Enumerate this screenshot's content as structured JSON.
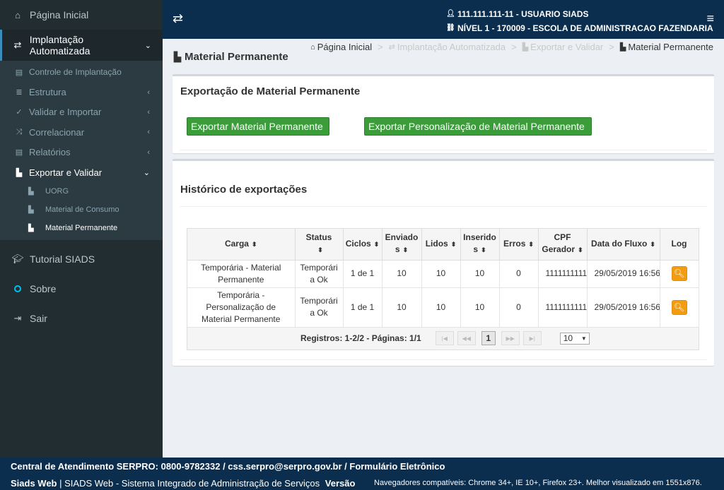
{
  "sidebar": {
    "home": "Página Inicial",
    "implantacao": "Implantação Automatizada",
    "sub": [
      {
        "label": "Controle de Implantação"
      },
      {
        "label": "Estrutura"
      },
      {
        "label": "Validar e Importar"
      },
      {
        "label": "Correlacionar"
      },
      {
        "label": "Relatórios"
      },
      {
        "label": "Exportar e Validar"
      }
    ],
    "sub2": [
      {
        "label": "UORG"
      },
      {
        "label": "Material de Consumo"
      },
      {
        "label": "Material Permanente"
      }
    ],
    "tutorial": "Tutorial SIADS",
    "sobre": "Sobre",
    "sair": "Sair"
  },
  "header": {
    "user": "111.111.111-11 - USUARIO SIADS",
    "level": "NÍVEL 1 - 170009 - ESCOLA DE ADMINISTRACAO FAZENDARIA"
  },
  "page": {
    "title": "Material Permanente",
    "breadcrumb": [
      "Página Inicial",
      "Implantação Automatizada",
      "Exportar e Validar",
      "Material Permanente"
    ]
  },
  "export_box": {
    "title": "Exportação de Material Permanente",
    "btn1": "Exportar Material Permanente",
    "btn2": "Exportar Personalização de Material Permanente"
  },
  "history": {
    "title": "Histórico de exportações",
    "columns": [
      "Carga",
      "Status",
      "Ciclos",
      "Enviados",
      "Lidos",
      "Inseridos",
      "Erros",
      "CPF Gerador",
      "Data do Fluxo",
      "Log"
    ],
    "rows": [
      {
        "carga": "Temporária - Material Permanente",
        "status": "Temporária Ok",
        "ciclos": "1 de 1",
        "enviados": "10",
        "lidos": "10",
        "inseridos": "10",
        "erros": "0",
        "cpf": "11111111111",
        "data": "29/05/2019 16:56"
      },
      {
        "carga": "Temporária - Personalização de Material Permanente",
        "status": "Temporária Ok",
        "ciclos": "1 de 1",
        "enviados": "10",
        "lidos": "10",
        "inseridos": "10",
        "erros": "0",
        "cpf": "11111111111",
        "data": "29/05/2019 16:56"
      }
    ],
    "pager": {
      "info": "Registros: 1-2/2 - Páginas: 1/1",
      "current": "1",
      "page_size": "10"
    }
  },
  "footer": {
    "line1": "Central de Atendimento SERPRO: 0800-9782332 / css.serpro@serpro.gov.br / Formulário Eletrônico",
    "app": "Siads Web",
    "system": " | SIADS Web - Sistema Integrado de Administração de Serviços ",
    "version": "Versão",
    "browsers": "Navegadores compatíveis: Chrome 34+, IE 10+, Firefox 23+. Melhor visualizado em 1551x876."
  }
}
